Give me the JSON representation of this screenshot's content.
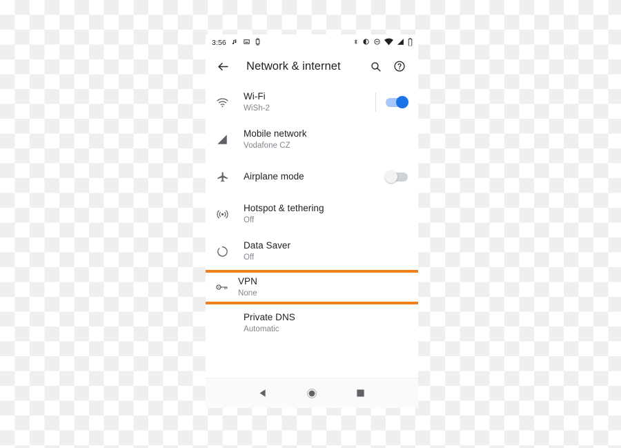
{
  "status_bar": {
    "clock": "3:56",
    "left_icons": [
      "music-note-icon",
      "screenshot-icon",
      "wear-watch-icon"
    ],
    "right_icons": [
      "bluetooth-icon",
      "vibrate-icon",
      "do-not-disturb-icon",
      "wifi-icon",
      "cellular-signal-icon",
      "battery-icon"
    ]
  },
  "toolbar": {
    "back_icon": "back-arrow-icon",
    "title": "Network & internet",
    "search_icon": "search-icon",
    "help_icon": "help-icon"
  },
  "list": [
    {
      "icon": "wifi-icon",
      "title": "Wi-Fi",
      "subtitle": "WiSh-2",
      "toggle": "on",
      "divider": true
    },
    {
      "icon": "cellular-signal-icon",
      "title": "Mobile network",
      "subtitle": "Vodafone CZ",
      "toggle": null,
      "divider": false
    },
    {
      "icon": "airplane-icon",
      "title": "Airplane mode",
      "subtitle": "",
      "toggle": "off",
      "divider": false
    },
    {
      "icon": "hotspot-icon",
      "title": "Hotspot & tethering",
      "subtitle": "Off",
      "toggle": null,
      "divider": false
    },
    {
      "icon": "data-saver-icon",
      "title": "Data Saver",
      "subtitle": "Off",
      "toggle": null,
      "divider": false
    },
    {
      "icon": "key-icon",
      "title": "VPN",
      "subtitle": "None",
      "toggle": null,
      "divider": false,
      "highlighted": true
    },
    {
      "icon": "",
      "title": "Private DNS",
      "subtitle": "Automatic",
      "toggle": null,
      "divider": false
    }
  ],
  "nav_bar": {
    "back": "nav-back-icon",
    "home": "nav-home-icon",
    "recents": "nav-recents-icon"
  },
  "colors": {
    "highlight": "#ef7f1a",
    "toggle_on": "#1a73e8",
    "toggle_on_track": "#a6c5fa",
    "toggle_off_track": "#cfd2d6",
    "primary_text": "#202124",
    "secondary_text": "#80868b"
  }
}
